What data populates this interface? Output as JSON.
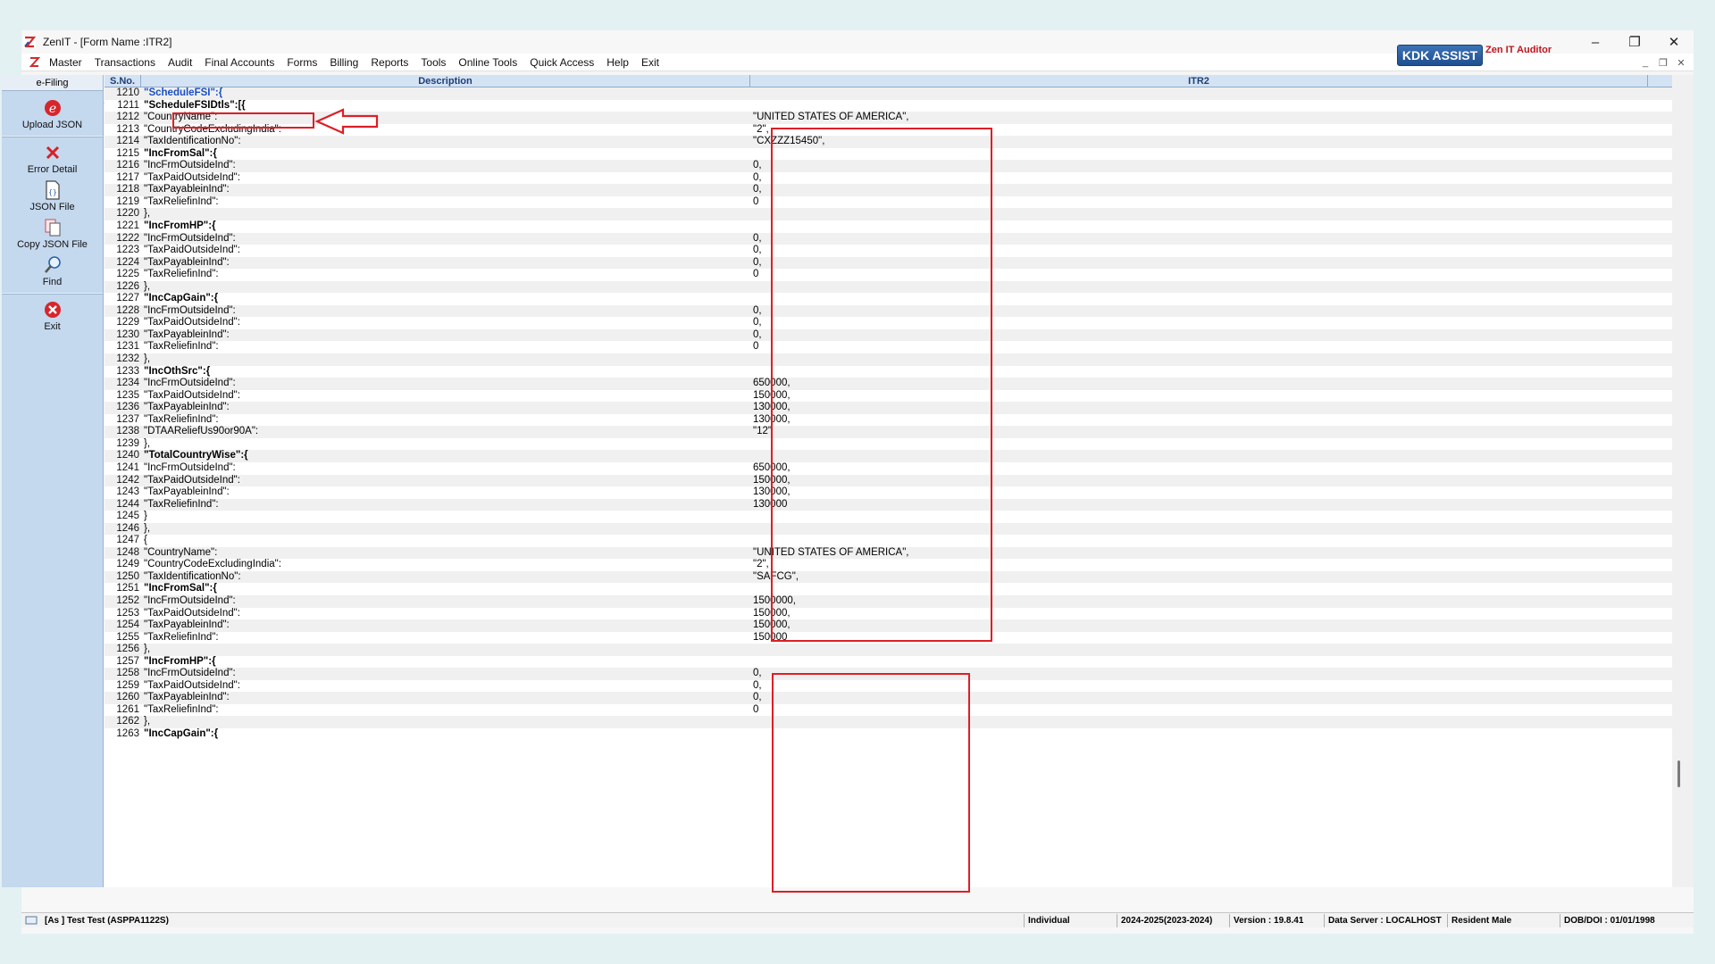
{
  "window": {
    "title": "ZenIT - [Form Name :ITR2]"
  },
  "menu": [
    "Master",
    "Transactions",
    "Audit",
    "Final Accounts",
    "Forms",
    "Billing",
    "Reports",
    "Tools",
    "Online Tools",
    "Quick Access",
    "Help",
    "Exit"
  ],
  "toolbar": {
    "kdk_label": "KDK ASSIST",
    "auditor_label": "Zen IT Auditor"
  },
  "sidebar": {
    "header": "e-Filing",
    "items": [
      {
        "label": "Upload JSON",
        "icon": "upload-json-icon"
      },
      {
        "label": "Error Detail",
        "icon": "error-x-icon"
      },
      {
        "label": "JSON File",
        "icon": "json-file-icon"
      },
      {
        "label": "Copy JSON File",
        "icon": "copy-file-icon"
      },
      {
        "label": "Find",
        "icon": "find-icon"
      },
      {
        "label": "Exit",
        "icon": "exit-icon"
      }
    ]
  },
  "grid": {
    "headers": {
      "sno": "S.No.",
      "desc": "Description",
      "itr": "ITR2"
    },
    "rows": [
      {
        "sno": "1210",
        "desc": "\"ScheduleFSI\":{",
        "val": ""
      },
      {
        "sno": "1211",
        "desc": "\"ScheduleFSIDtls\":[{",
        "val": ""
      },
      {
        "sno": "1212",
        "desc": "\"CountryName\":",
        "val": "\"UNITED STATES OF AMERICA\","
      },
      {
        "sno": "1213",
        "desc": "\"CountryCodeExcludingIndia\":",
        "val": "\"2\","
      },
      {
        "sno": "1214",
        "desc": "\"TaxIdentificationNo\":",
        "val": "\"CXZZZ15450\","
      },
      {
        "sno": "1215",
        "desc": "\"IncFromSal\":{",
        "val": ""
      },
      {
        "sno": "1216",
        "desc": "\"IncFrmOutsideInd\":",
        "val": "0,"
      },
      {
        "sno": "1217",
        "desc": "\"TaxPaidOutsideInd\":",
        "val": "0,"
      },
      {
        "sno": "1218",
        "desc": "\"TaxPayableinInd\":",
        "val": "0,"
      },
      {
        "sno": "1219",
        "desc": "\"TaxReliefinInd\":",
        "val": "0"
      },
      {
        "sno": "1220",
        "desc": "},",
        "val": ""
      },
      {
        "sno": "1221",
        "desc": "\"IncFromHP\":{",
        "val": ""
      },
      {
        "sno": "1222",
        "desc": "\"IncFrmOutsideInd\":",
        "val": "0,"
      },
      {
        "sno": "1223",
        "desc": "\"TaxPaidOutsideInd\":",
        "val": "0,"
      },
      {
        "sno": "1224",
        "desc": "\"TaxPayableinInd\":",
        "val": "0,"
      },
      {
        "sno": "1225",
        "desc": "\"TaxReliefinInd\":",
        "val": "0"
      },
      {
        "sno": "1226",
        "desc": "},",
        "val": ""
      },
      {
        "sno": "1227",
        "desc": "\"IncCapGain\":{",
        "val": ""
      },
      {
        "sno": "1228",
        "desc": "\"IncFrmOutsideInd\":",
        "val": "0,"
      },
      {
        "sno": "1229",
        "desc": "\"TaxPaidOutsideInd\":",
        "val": "0,"
      },
      {
        "sno": "1230",
        "desc": "\"TaxPayableinInd\":",
        "val": "0,"
      },
      {
        "sno": "1231",
        "desc": "\"TaxReliefinInd\":",
        "val": "0"
      },
      {
        "sno": "1232",
        "desc": "},",
        "val": ""
      },
      {
        "sno": "1233",
        "desc": "\"IncOthSrc\":{",
        "val": ""
      },
      {
        "sno": "1234",
        "desc": "\"IncFrmOutsideInd\":",
        "val": "650000,"
      },
      {
        "sno": "1235",
        "desc": "\"TaxPaidOutsideInd\":",
        "val": "150000,"
      },
      {
        "sno": "1236",
        "desc": "\"TaxPayableinInd\":",
        "val": "130000,"
      },
      {
        "sno": "1237",
        "desc": "\"TaxReliefinInd\":",
        "val": "130000,"
      },
      {
        "sno": "1238",
        "desc": "\"DTAAReliefUs90or90A\":",
        "val": "\"12\""
      },
      {
        "sno": "1239",
        "desc": "},",
        "val": ""
      },
      {
        "sno": "1240",
        "desc": "\"TotalCountryWise\":{",
        "val": ""
      },
      {
        "sno": "1241",
        "desc": "\"IncFrmOutsideInd\":",
        "val": "650000,"
      },
      {
        "sno": "1242",
        "desc": "\"TaxPaidOutsideInd\":",
        "val": "150000,"
      },
      {
        "sno": "1243",
        "desc": "\"TaxPayableinInd\":",
        "val": "130000,"
      },
      {
        "sno": "1244",
        "desc": "\"TaxReliefinInd\":",
        "val": "130000"
      },
      {
        "sno": "1245",
        "desc": "}",
        "val": ""
      },
      {
        "sno": "1246",
        "desc": "},",
        "val": ""
      },
      {
        "sno": "1247",
        "desc": "{",
        "val": ""
      },
      {
        "sno": "1248",
        "desc": "\"CountryName\":",
        "val": "\"UNITED STATES OF AMERICA\","
      },
      {
        "sno": "1249",
        "desc": "\"CountryCodeExcludingIndia\":",
        "val": "\"2\","
      },
      {
        "sno": "1250",
        "desc": "\"TaxIdentificationNo\":",
        "val": "\"SAFCG\","
      },
      {
        "sno": "1251",
        "desc": "\"IncFromSal\":{",
        "val": ""
      },
      {
        "sno": "1252",
        "desc": "\"IncFrmOutsideInd\":",
        "val": "1500000,"
      },
      {
        "sno": "1253",
        "desc": "\"TaxPaidOutsideInd\":",
        "val": "150000,"
      },
      {
        "sno": "1254",
        "desc": "\"TaxPayableinInd\":",
        "val": "150000,"
      },
      {
        "sno": "1255",
        "desc": "\"TaxReliefinInd\":",
        "val": "150000"
      },
      {
        "sno": "1256",
        "desc": "},",
        "val": ""
      },
      {
        "sno": "1257",
        "desc": "\"IncFromHP\":{",
        "val": ""
      },
      {
        "sno": "1258",
        "desc": "\"IncFrmOutsideInd\":",
        "val": "0,"
      },
      {
        "sno": "1259",
        "desc": "\"TaxPaidOutsideInd\":",
        "val": "0,"
      },
      {
        "sno": "1260",
        "desc": "\"TaxPayableinInd\":",
        "val": "0,"
      },
      {
        "sno": "1261",
        "desc": "\"TaxReliefinInd\":",
        "val": "0"
      },
      {
        "sno": "1262",
        "desc": "},",
        "val": ""
      },
      {
        "sno": "1263",
        "desc": "\"IncCapGain\":{",
        "val": ""
      }
    ]
  },
  "status": {
    "user": "[As ] Test Test (ASPPA1122S)",
    "type": "Individual",
    "year": "2024-2025(2023-2024)",
    "version": "Version : 19.8.41",
    "server": "Data Server : LOCALHOST",
    "residency": "Resident Male",
    "dob": "DOB/DOI : 01/01/1998"
  },
  "colors": {
    "annotation": "#dd1f26",
    "highlight_text": "#1a4fc4",
    "kdk": "#2a5fa3"
  }
}
